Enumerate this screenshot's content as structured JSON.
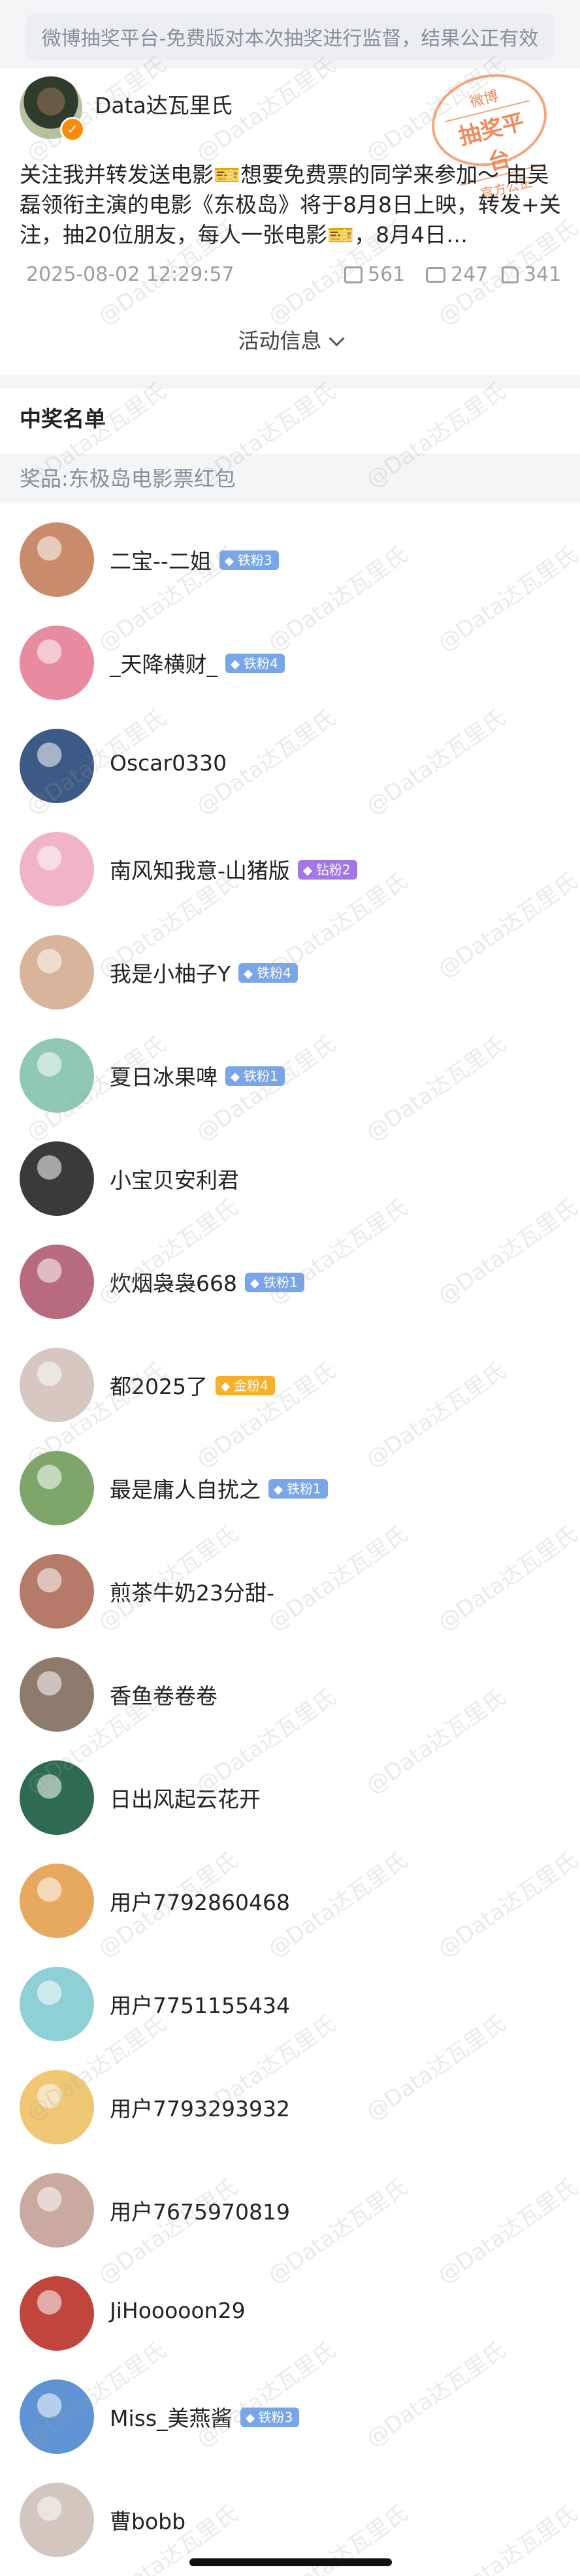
{
  "notice": {
    "platform": "微博抽奖平台-免费版",
    "text": " 对本次抽奖进行监督，结果公正有效"
  },
  "post": {
    "author": "Data达瓦里氏",
    "text": "关注我并转发送电影🎫想要免费票的同学来参加～ 由吴磊领衔主演的电影《东极岛》将于8月8日上映，转发+关注，抽20位朋友，每人一张电影🎫，8月4日…",
    "date": "2025-08-02 12:29:57",
    "shares": "561",
    "comments": "247",
    "likes": "341",
    "activity_label": "活动信息"
  },
  "stamp": {
    "line1": "微博",
    "line2": "抽奖平台",
    "line3": "官方公正"
  },
  "watermark": "@Data达瓦里氏",
  "winners": {
    "title": "中奖名单",
    "prize": "奖品:东极岛电影票红包",
    "list": [
      {
        "name": "二宝--二姐",
        "badge": "铁粉3",
        "badge_type": "iron",
        "color": "#c98b6c"
      },
      {
        "name": "_天降横财_",
        "badge": "铁粉4",
        "badge_type": "iron",
        "color": "#e88aa0"
      },
      {
        "name": "Oscar0330",
        "badge": "",
        "badge_type": "",
        "color": "#3c5a86"
      },
      {
        "name": "南风知我意-山猪版",
        "badge": "钻粉2",
        "badge_type": "dia",
        "color": "#f1b3c8"
      },
      {
        "name": "我是小柚子Y",
        "badge": "铁粉4",
        "badge_type": "iron",
        "color": "#d8b49a"
      },
      {
        "name": "夏日冰果啤",
        "badge": "铁粉1",
        "badge_type": "iron",
        "color": "#8fc9b4"
      },
      {
        "name": "小宝贝安利君",
        "badge": "",
        "badge_type": "",
        "color": "#3a3a3a"
      },
      {
        "name": "炊烟袅袅668",
        "badge": "铁粉1",
        "badge_type": "iron",
        "color": "#b86a7e"
      },
      {
        "name": "都2025了",
        "badge": "金粉4",
        "badge_type": "gold",
        "color": "#d6c7c0"
      },
      {
        "name": "最是庸人自扰之",
        "badge": "铁粉1",
        "badge_type": "iron",
        "color": "#7fa66a"
      },
      {
        "name": "煎茶牛奶23分甜-",
        "badge": "",
        "badge_type": "",
        "color": "#b57a68"
      },
      {
        "name": "香鱼卷卷卷",
        "badge": "",
        "badge_type": "",
        "color": "#8f7a6e"
      },
      {
        "name": "日出风起云花开",
        "badge": "",
        "badge_type": "",
        "color": "#2f6b52"
      },
      {
        "name": "用户7792860468",
        "badge": "",
        "badge_type": "",
        "color": "#e7a860"
      },
      {
        "name": "用户7751155434",
        "badge": "",
        "badge_type": "",
        "color": "#8fd0d6"
      },
      {
        "name": "用户7793293932",
        "badge": "",
        "badge_type": "",
        "color": "#f0c774"
      },
      {
        "name": "用户7675970819",
        "badge": "",
        "badge_type": "",
        "color": "#c9a9a0"
      },
      {
        "name": "JiHooooon29",
        "badge": "",
        "badge_type": "",
        "color": "#c0453d"
      },
      {
        "name": "Miss_美燕酱",
        "badge": "铁粉3",
        "badge_type": "iron",
        "color": "#5f93d4"
      },
      {
        "name": "曹bobb",
        "badge": "",
        "badge_type": "",
        "color": "#d2c6bf"
      }
    ]
  }
}
